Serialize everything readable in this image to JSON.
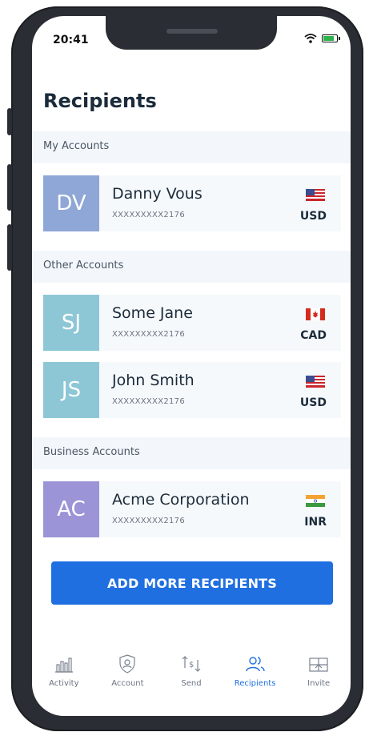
{
  "status": {
    "time": "20:41"
  },
  "title": "Recipients",
  "sections": {
    "my_accounts": "My Accounts",
    "other_accounts": "Other Accounts",
    "business_accounts": "Business Accounts"
  },
  "recipients": [
    {
      "initials": "DV",
      "name": "Danny Vous",
      "account": "XXXXXXXXX2176",
      "currency": "USD",
      "flag": "us-flag",
      "color": "#8fa7d6"
    },
    {
      "initials": "SJ",
      "name": "Some Jane",
      "account": "XXXXXXXXX2176",
      "currency": "CAD",
      "flag": "canada-flag",
      "color": "#8dc7d6"
    },
    {
      "initials": "JS",
      "name": "John Smith",
      "account": "XXXXXXXXX2176",
      "currency": "USD",
      "flag": "us-flag",
      "color": "#8dc7d6"
    },
    {
      "initials": "AC",
      "name": "Acme Corporation",
      "account": "XXXXXXXXX2176",
      "currency": "INR",
      "flag": "india-flag",
      "color": "#9b94d6"
    }
  ],
  "add_button": "ADD MORE RECIPIENTS",
  "nav": [
    {
      "label": "Activity",
      "icon": "chart-icon"
    },
    {
      "label": "Account",
      "icon": "shield-icon"
    },
    {
      "label": "Send",
      "icon": "transfer-icon"
    },
    {
      "label": "Recipients",
      "icon": "people-icon"
    },
    {
      "label": "Invite",
      "icon": "gift-icon"
    }
  ],
  "colors": {
    "accent": "#1f6fe0",
    "frame": "#2a2d33"
  }
}
